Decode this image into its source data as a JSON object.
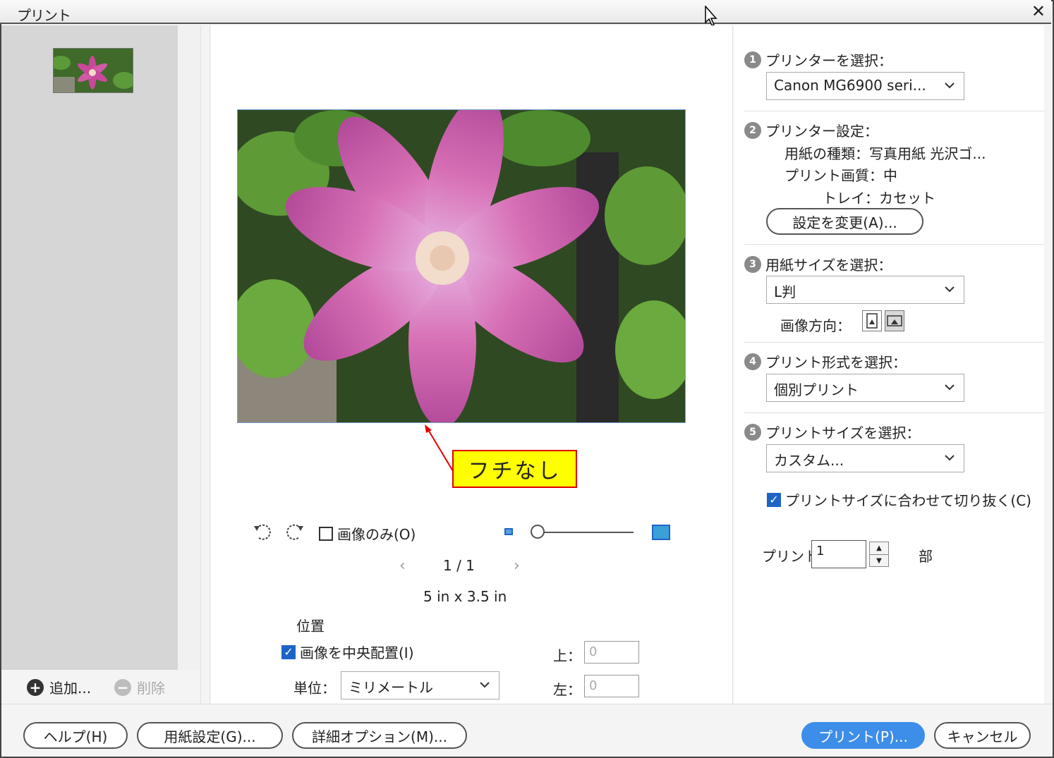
{
  "window": {
    "title": "プリント"
  },
  "left": {
    "add_label": "追加...",
    "delete_label": "削除"
  },
  "preview": {
    "annotation": "フチなし",
    "image_only_label": "画像のみ(O)",
    "page_indicator": "1 / 1",
    "size_text": "5 in x 3.5 in",
    "position_label": "位置",
    "center_label": "画像を中央配置(I)",
    "unit_label": "単位：",
    "unit_value": "ミリメートル",
    "top_label": "上：",
    "top_value": "0",
    "left_label": "左：",
    "left_value": "0"
  },
  "settings": {
    "step1": {
      "number": "1",
      "label": "プリンターを選択：",
      "value": "Canon MG6900 seri..."
    },
    "step2": {
      "number": "2",
      "label": "プリンター設定：",
      "paper_type": "用紙の種類：写真用紙 光沢ゴ...",
      "print_quality": "プリント画質：中",
      "tray": "トレイ：カセット",
      "change_button": "設定を変更(A)..."
    },
    "step3": {
      "number": "3",
      "label": "用紙サイズを選択：",
      "value": "L判",
      "orientation_label": "画像方向："
    },
    "step4": {
      "number": "4",
      "label": "プリント形式を選択：",
      "value": "個別プリント"
    },
    "step5": {
      "number": "5",
      "label": "プリントサイズを選択：",
      "value": "カスタム...",
      "crop_label": "プリントサイズに合わせて切り抜く(C)"
    },
    "copies_label": "プリント",
    "copies_value": "1",
    "copies_unit": "部"
  },
  "buttons": {
    "help": "ヘルプ(H)",
    "page_setup": "用紙設定(G)...",
    "more_options": "詳細オプション(M)...",
    "print": "プリント(P)...",
    "cancel": "キャンセル"
  },
  "colors": {
    "primary": "#3d8ee8",
    "annotation_bg": "#ffff00",
    "annotation_border": "#e00000",
    "checkbox": "#1e64c8"
  }
}
